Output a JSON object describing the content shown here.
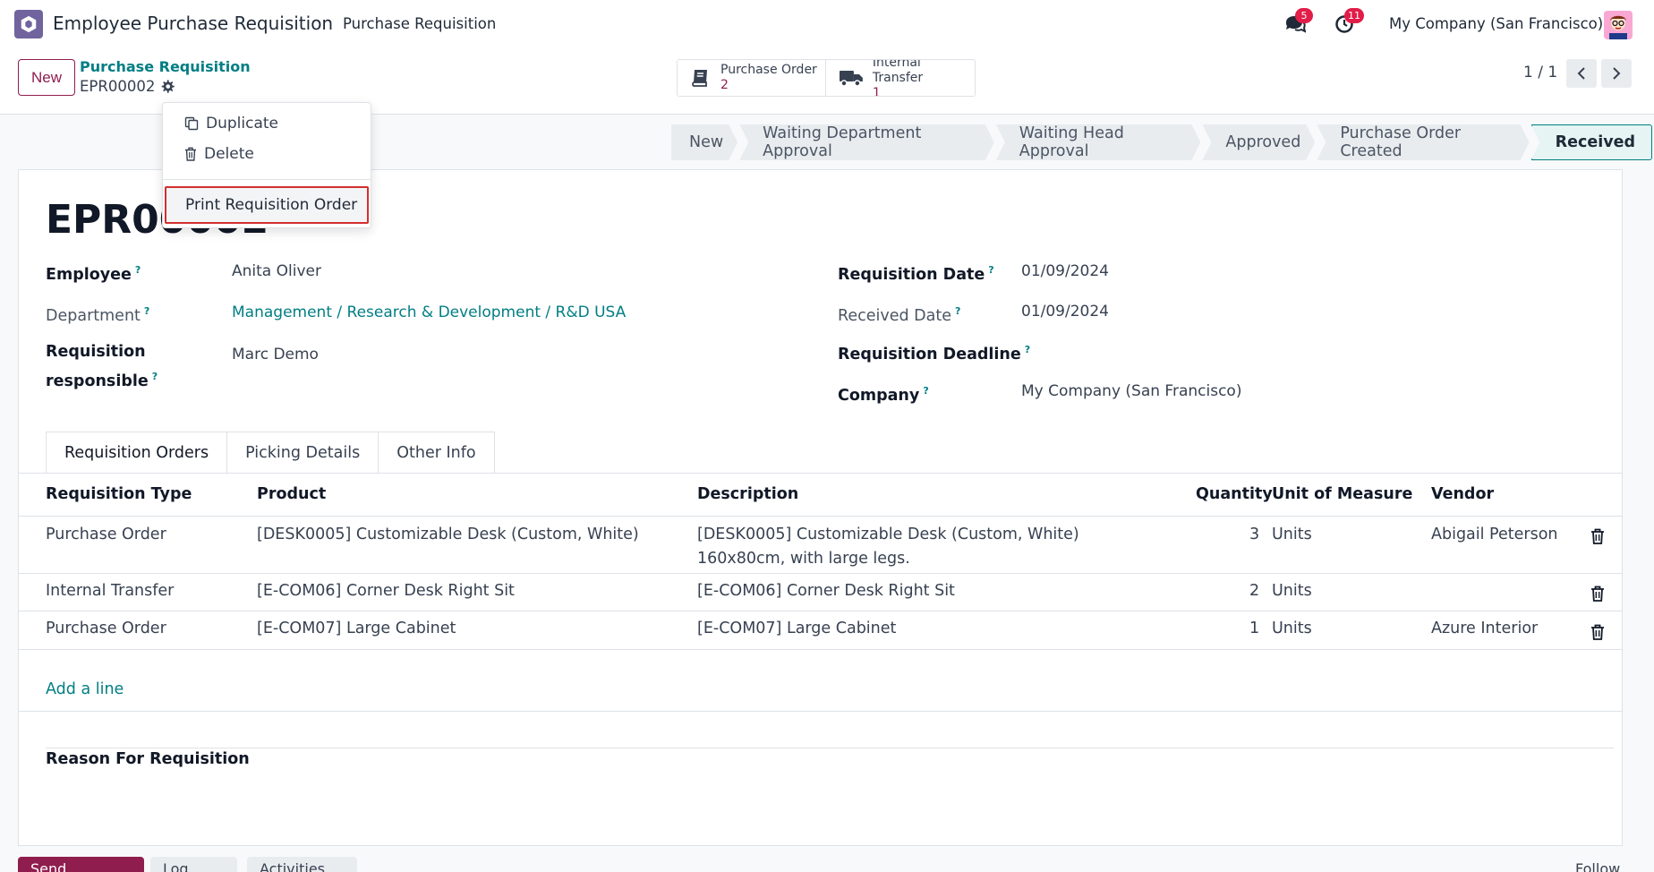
{
  "navbar": {
    "app_name": "Employee Purchase Requisition",
    "menu_item": "Purchase Requisition",
    "messages_badge": "5",
    "activities_badge": "11",
    "company": "My Company (San Francisco)"
  },
  "control": {
    "new_label": "New",
    "breadcrumb_parent": "Purchase Requisition",
    "breadcrumb_current": "EPR00002",
    "smart_buttons": [
      {
        "label": "Purchase Order",
        "count": "2",
        "icon": "book-icon"
      },
      {
        "label": "Internal Transfer",
        "count": "1",
        "icon": "truck-icon"
      }
    ],
    "pager": "1 / 1"
  },
  "stages": [
    "New",
    "Waiting Department Approval",
    "Waiting Head Approval",
    "Approved",
    "Purchase Order Created",
    "Received"
  ],
  "active_stage": "Received",
  "record": {
    "title": "EPR00002",
    "fields_left": [
      {
        "label": "Employee",
        "value": "Anita Oliver"
      },
      {
        "label": "Department",
        "value": "Management / Research & Development / R&D USA"
      },
      {
        "label": "Requisition",
        "label2": "responsible",
        "value": "Marc Demo"
      }
    ],
    "fields_right": [
      {
        "label": "Requisition Date",
        "value": "01/09/2024"
      },
      {
        "label": "Received Date",
        "value": "01/09/2024"
      },
      {
        "label": "Requisition Deadline",
        "value": ""
      },
      {
        "label": "Company",
        "value": "My Company (San Francisco)"
      }
    ],
    "help_mark": "?"
  },
  "tabs": [
    "Requisition Orders",
    "Picking Details",
    "Other Info"
  ],
  "table": {
    "headers": [
      "Requisition Type",
      "Product",
      "Description",
      "Quantity",
      "Unit of Measure",
      "Vendor"
    ],
    "rows": [
      {
        "type": "Purchase Order",
        "product": "[DESK0005] Customizable Desk (Custom, White)",
        "desc1": "[DESK0005] Customizable Desk (Custom, White)",
        "desc2": "160x80cm, with large legs.",
        "qty": "3",
        "uom": "Units",
        "vendor": "Abigail Peterson"
      },
      {
        "type": "Internal Transfer",
        "product": "[E-COM06] Corner Desk Right Sit",
        "desc1": "[E-COM06] Corner Desk Right Sit",
        "desc2": "",
        "qty": "2",
        "uom": "Units",
        "vendor": ""
      },
      {
        "type": "Purchase Order",
        "product": "[E-COM07] Large Cabinet",
        "desc1": "[E-COM07] Large Cabinet",
        "desc2": "",
        "qty": "1",
        "uom": "Units",
        "vendor": "Azure Interior"
      }
    ],
    "add_line": "Add a line"
  },
  "reason_label": "Reason For Requisition",
  "dropdown": {
    "duplicate": "Duplicate",
    "delete": "Delete",
    "print": "Print Requisition Order"
  },
  "chatter": {
    "send_message": "Send message",
    "log_note": "Log note",
    "activities": "Activities",
    "follow": "Follow"
  },
  "colors": {
    "brand": "#71639e",
    "primary": "#8f1d4e",
    "link": "#017e84",
    "highlight_border": "#d32f2f"
  }
}
